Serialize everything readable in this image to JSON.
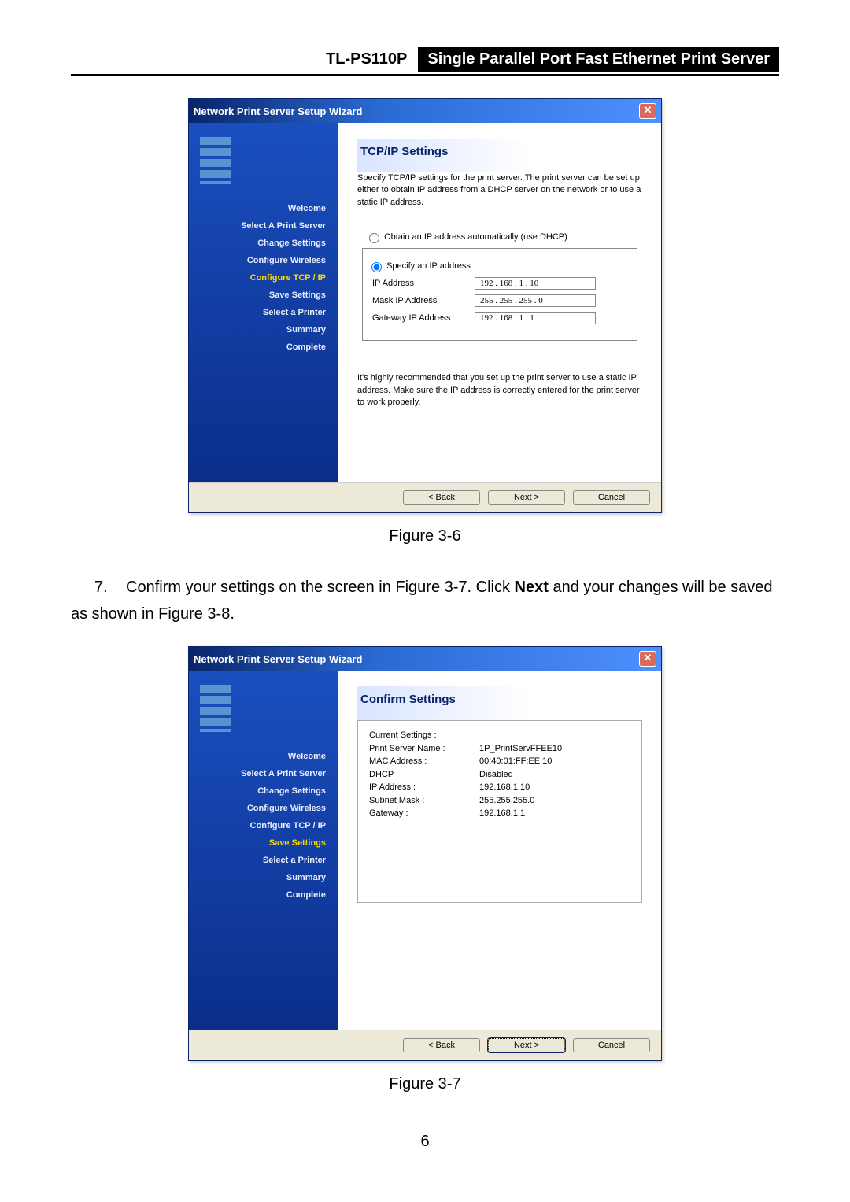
{
  "header": {
    "model": "TL-PS110P",
    "product_title": "Single Parallel Port Fast Ethernet Print Server"
  },
  "dialog1": {
    "window_title": "Network Print Server Setup Wizard",
    "close_glyph": "✕",
    "sidebar_steps": [
      "Welcome",
      "Select A Print Server",
      "Change Settings",
      "Configure Wireless",
      "Configure TCP / IP",
      "Save Settings",
      "Select a Printer",
      "Summary",
      "Complete"
    ],
    "active_step_index": 4,
    "heading": "TCP/IP Settings",
    "description": "Specify TCP/IP settings for the print server. The print server can be set up either to obtain IP address from a DHCP server on the network or to use a static IP address.",
    "radio_dhcp": "Obtain an IP address automatically (use DHCP)",
    "radio_static": "Specify an IP address",
    "ip_label": "IP Address",
    "ip_value": "192 . 168 .  1 .  10",
    "mask_label": "Mask IP Address",
    "mask_value": "255 . 255 . 255 .  0",
    "gw_label": "Gateway IP Address",
    "gw_value": "192 . 168 .  1 .  1",
    "note": "It's highly recommended that you set up the print server to use a static IP address. Make sure the IP address is correctly entered for the print server to work properly.",
    "back": "< Back",
    "next": "Next >",
    "cancel": "Cancel"
  },
  "caption1": "Figure 3-6",
  "body_step": {
    "number": "7.",
    "text_a": "Confirm your settings on the screen in Figure 3-7. Click ",
    "bold": "Next",
    "text_b": " and your changes will be saved as shown in Figure 3-8."
  },
  "dialog2": {
    "window_title": "Network Print Server Setup Wizard",
    "close_glyph": "✕",
    "sidebar_steps": [
      "Welcome",
      "Select A Print Server",
      "Change Settings",
      "Configure Wireless",
      "Configure TCP / IP",
      "Save Settings",
      "Select a Printer",
      "Summary",
      "Complete"
    ],
    "active_step_index": 5,
    "heading": "Confirm Settings",
    "current_label": "Current Settings :",
    "rows": [
      {
        "k": "Print Server Name :",
        "v": "1P_PrintServFFEE10"
      },
      {
        "k": "MAC Address :",
        "v": "00:40:01:FF:EE:10"
      },
      {
        "k": "",
        "v": ""
      },
      {
        "k": "DHCP :",
        "v": "Disabled"
      },
      {
        "k": "IP Address :",
        "v": "192.168.1.10"
      },
      {
        "k": "Subnet Mask :",
        "v": "255.255.255.0"
      },
      {
        "k": "Gateway :",
        "v": "192.168.1.1"
      }
    ],
    "back": "< Back",
    "next": "Next >",
    "cancel": "Cancel"
  },
  "caption2": "Figure 3-7",
  "page_number": "6"
}
